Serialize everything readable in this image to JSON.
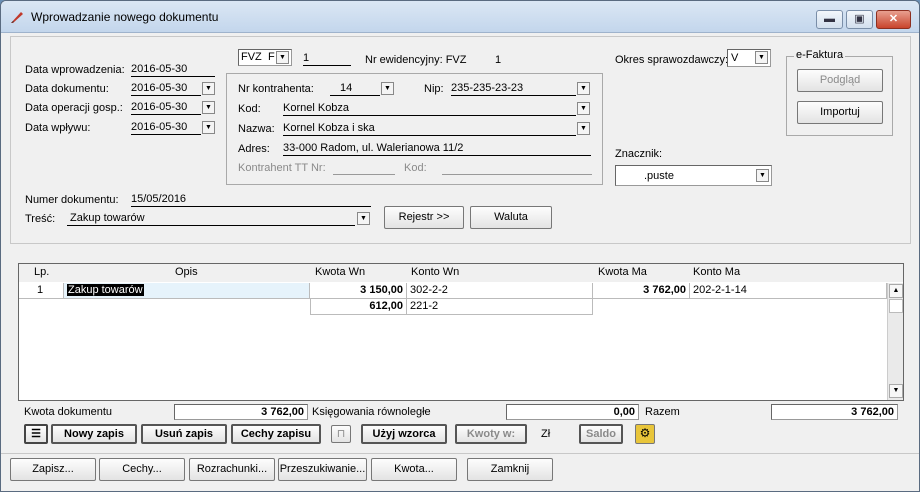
{
  "window": {
    "title": "Wprowadzanie nowego dokumentu",
    "min": "▬",
    "max": "▣",
    "close": "✕"
  },
  "dates": {
    "entry_label": "Data wprowadzenia:",
    "entry_value": "2016-05-30",
    "doc_label": "Data dokumentu:",
    "doc_value": "2016-05-30",
    "op_label": "Data operacji gosp.:",
    "op_value": "2016-05-30",
    "inflow_label": "Data wpływu:",
    "inflow_value": "2016-05-30"
  },
  "doc_type": {
    "value": "FVZ",
    "trunc": "F",
    "number": "1",
    "evid_label": "Nr ewidencyjny: FVZ",
    "evid_number": "1"
  },
  "contractor": {
    "nr_label": "Nr kontrahenta:",
    "nr_value": "14",
    "nip_label": "Nip:",
    "nip_value": "235-235-23-23",
    "kod_label": "Kod:",
    "kod_value": "Kornel Kobza",
    "nazwa_label": "Nazwa:",
    "nazwa_value": "Kornel Kobza i ska",
    "adres_label": "Adres:",
    "adres_value": "33-000 Radom, ul. Walerianowa 11/2",
    "tt_label": "Kontrahent TT Nr:",
    "tt_kod_label": "Kod:"
  },
  "period": {
    "label": "Okres sprawozdawczy:",
    "value": "V"
  },
  "efaktura": {
    "title": "e-Faktura",
    "preview": "Podgląd",
    "import": "Importuj"
  },
  "znacznik": {
    "label": "Znacznik:",
    "value": ".puste"
  },
  "document": {
    "number_label": "Numer dokumentu:",
    "number_value": "15/05/2016",
    "tresc_label": "Treść:",
    "tresc_value": "Zakup towarów",
    "rejestr": "Rejestr >>",
    "waluta": "Waluta"
  },
  "table": {
    "headers": {
      "lp": "Lp.",
      "opis": "Opis",
      "kwota_wn": "Kwota  Wn",
      "konto_wn": "Konto  Wn",
      "kwota_ma": "Kwota Ma",
      "konto_ma": "Konto Ma"
    },
    "rows": [
      {
        "lp": "1",
        "opis": "Zakup towarów",
        "kwota_wn": "3 150,00",
        "konto_wn": "302-2-2",
        "kwota_ma": "3 762,00",
        "konto_ma": "202-2-1-14"
      },
      {
        "lp": "",
        "opis": "",
        "kwota_wn": "612,00",
        "konto_wn": "221-2",
        "kwota_ma": "",
        "konto_ma": ""
      }
    ]
  },
  "totals": {
    "kwota_label": "Kwota dokumentu",
    "kwota_value": "3 762,00",
    "ksieg_label": "Księgowania równoległe",
    "ksieg_value": "0,00",
    "razem_label": "Razem",
    "razem_value": "3 762,00"
  },
  "entry_toolbar": {
    "new": "Nowy zapis",
    "delete": "Usuń zapis",
    "features": "Cechy zapisu",
    "use_template": "Użyj wzorca",
    "amounts": "Kwoty w:",
    "currency": "Zł",
    "balance": "Saldo"
  },
  "bottom": {
    "save": "Zapisz...",
    "features": "Cechy...",
    "settlements": "Rozrachunki...",
    "search": "Przeszukiwanie...",
    "amount": "Kwota...",
    "close": "Zamknij"
  }
}
